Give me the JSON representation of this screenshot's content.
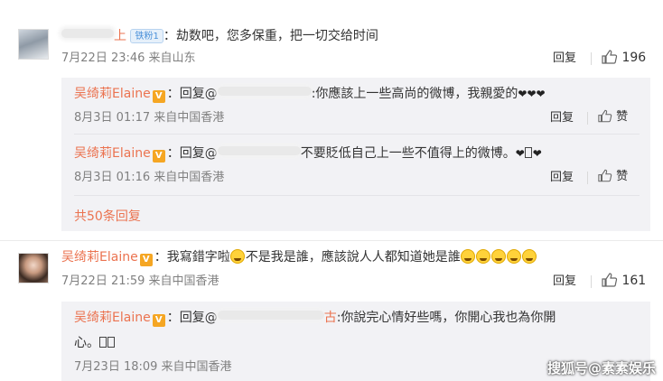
{
  "comments": [
    {
      "name_visible": "上",
      "badge": "铁粉1",
      "text": "：劫数吧，您多保重，把一切交给时间",
      "time": "7月22日 23:46 来自山东",
      "reply_label": "回复",
      "likes": "196",
      "replies": [
        {
          "name": "吴绮莉Elaine",
          "prefix": "：回复@",
          "text": ":你應該上一些高尚的微博，我親愛的",
          "hearts": "❤❤❤",
          "time": "8月3日 01:17 来自中国香港",
          "reply_label": "回复",
          "like_label": "赞"
        },
        {
          "name": "吴绮莉Elaine",
          "prefix": "：回复@",
          "text": "不要貶低自己上一些不值得上的微博。",
          "hearts_end": "❤",
          "time": "8月3日 01:16 来自中国香港",
          "reply_label": "回复",
          "like_label": "赞"
        }
      ],
      "more_replies": "共50条回复"
    },
    {
      "name": "吴绮莉Elaine",
      "text_a": "：我寫錯字啦",
      "text_b": "不是我是誰，應該說人人都知道她是誰",
      "time": "7月22日 21:59 来自中国香港",
      "reply_label": "回复",
      "likes": "161",
      "replies": [
        {
          "name": "吴绮莉Elaine",
          "prefix": "：回复@",
          "text_suffix": "古",
          "text": ":你說完心情好些嗎，你開心我也為你開",
          "text_line2": "心。",
          "time": "7月23日 18:09 来自中国香港"
        }
      ]
    }
  ],
  "watermark": "搜狐号@素素娱乐",
  "colors": {
    "name": "#eb7350",
    "meta": "#808080",
    "reply_bg": "#f2f2f5",
    "vip": "#f5a623"
  }
}
